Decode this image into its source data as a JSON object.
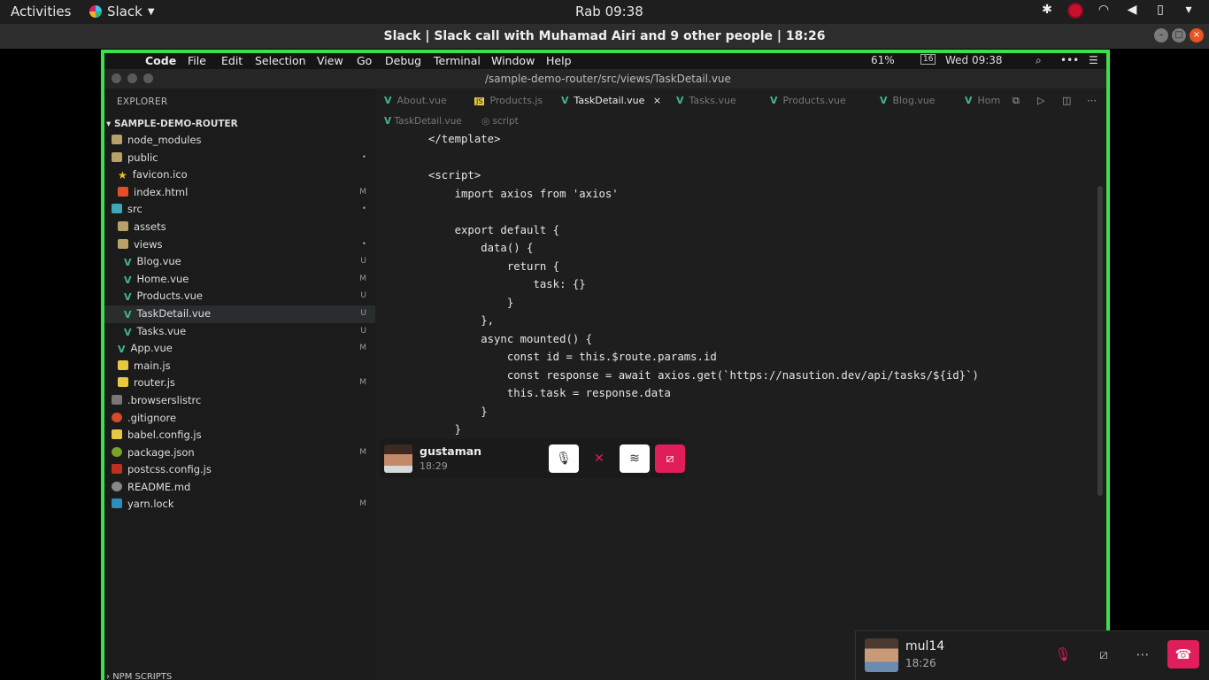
{
  "topbar": {
    "activities": "Activities",
    "app_name": "Slack",
    "clock": "Rab 09:38"
  },
  "window": {
    "title": "Slack | Slack call with Muhamad Airi and 9 other people | 18:26"
  },
  "mac_menu": {
    "app": "Code",
    "items": [
      "File",
      "Edit",
      "Selection",
      "View",
      "Go",
      "Debug",
      "Terminal",
      "Window",
      "Help"
    ],
    "battery": "61%",
    "date_badge": "16",
    "clock": "Wed 09:38"
  },
  "vscode": {
    "path": "/sample-demo-router/src/views/TaskDetail.vue",
    "explorer_header": "EXPLORER",
    "project": "SAMPLE-DEMO-ROUTER",
    "files": [
      {
        "name": "node_modules",
        "icon": "folder",
        "indent": 1,
        "status": ""
      },
      {
        "name": "public",
        "icon": "folder",
        "indent": 1,
        "status": "•"
      },
      {
        "name": "favicon.ico",
        "icon": "star",
        "indent": 2,
        "status": ""
      },
      {
        "name": "index.html",
        "icon": "html",
        "indent": 2,
        "status": "M"
      },
      {
        "name": "src",
        "icon": "folder-open",
        "indent": 1,
        "status": "•"
      },
      {
        "name": "assets",
        "icon": "folder",
        "indent": 2,
        "status": ""
      },
      {
        "name": "views",
        "icon": "folder",
        "indent": 2,
        "status": "•"
      },
      {
        "name": "Blog.vue",
        "icon": "vue",
        "indent": 3,
        "status": "U"
      },
      {
        "name": "Home.vue",
        "icon": "vue",
        "indent": 3,
        "status": "M"
      },
      {
        "name": "Products.vue",
        "icon": "vue",
        "indent": 3,
        "status": "U"
      },
      {
        "name": "TaskDetail.vue",
        "icon": "vue",
        "indent": 3,
        "status": "U"
      },
      {
        "name": "Tasks.vue",
        "icon": "vue",
        "indent": 3,
        "status": "U"
      },
      {
        "name": "App.vue",
        "icon": "vue",
        "indent": 2,
        "status": "M"
      },
      {
        "name": "main.js",
        "icon": "js",
        "indent": 2,
        "status": ""
      },
      {
        "name": "router.js",
        "icon": "js",
        "indent": 2,
        "status": "M"
      },
      {
        "name": ".browserslistrc",
        "icon": "file",
        "indent": 1,
        "status": ""
      },
      {
        "name": ".gitignore",
        "icon": "git",
        "indent": 1,
        "status": ""
      },
      {
        "name": "babel.config.js",
        "icon": "babel",
        "indent": 1,
        "status": ""
      },
      {
        "name": "package.json",
        "icon": "node",
        "indent": 1,
        "status": "M"
      },
      {
        "name": "postcss.config.js",
        "icon": "post",
        "indent": 1,
        "status": ""
      },
      {
        "name": "README.md",
        "icon": "info",
        "indent": 1,
        "status": ""
      },
      {
        "name": "yarn.lock",
        "icon": "yarn",
        "indent": 1,
        "status": "M"
      }
    ],
    "npm_scripts": "NPM SCRIPTS",
    "tabs": [
      {
        "label": "About.vue",
        "type": "vue",
        "active": false
      },
      {
        "label": "Products.js",
        "type": "js",
        "active": false
      },
      {
        "label": "TaskDetail.vue",
        "type": "vue",
        "active": true
      },
      {
        "label": "Tasks.vue",
        "type": "vue",
        "active": false
      },
      {
        "label": "Products.vue",
        "type": "vue",
        "active": false
      },
      {
        "label": "Blog.vue",
        "type": "vue",
        "active": false
      },
      {
        "label": "Hom",
        "type": "vue",
        "active": false
      }
    ],
    "breadcrumb": [
      "TaskDetail.vue",
      "script"
    ],
    "code": [
      "</template>",
      "",
      "<script>",
      "    import axios from 'axios'",
      "",
      "    export default {",
      "        data() {",
      "            return {",
      "                task: {}",
      "            }",
      "        },",
      "        async mounted() {",
      "            const id = this.$route.params.id",
      "            const response = await axios.get(`https://nasution.dev/api/tasks/${id}`)",
      "            this.task = response.data",
      "        }",
      "    }"
    ]
  },
  "call_tile": {
    "name": "gustaman",
    "time": "18:29"
  },
  "self_bar": {
    "name": "mul14",
    "time": "18:26"
  }
}
